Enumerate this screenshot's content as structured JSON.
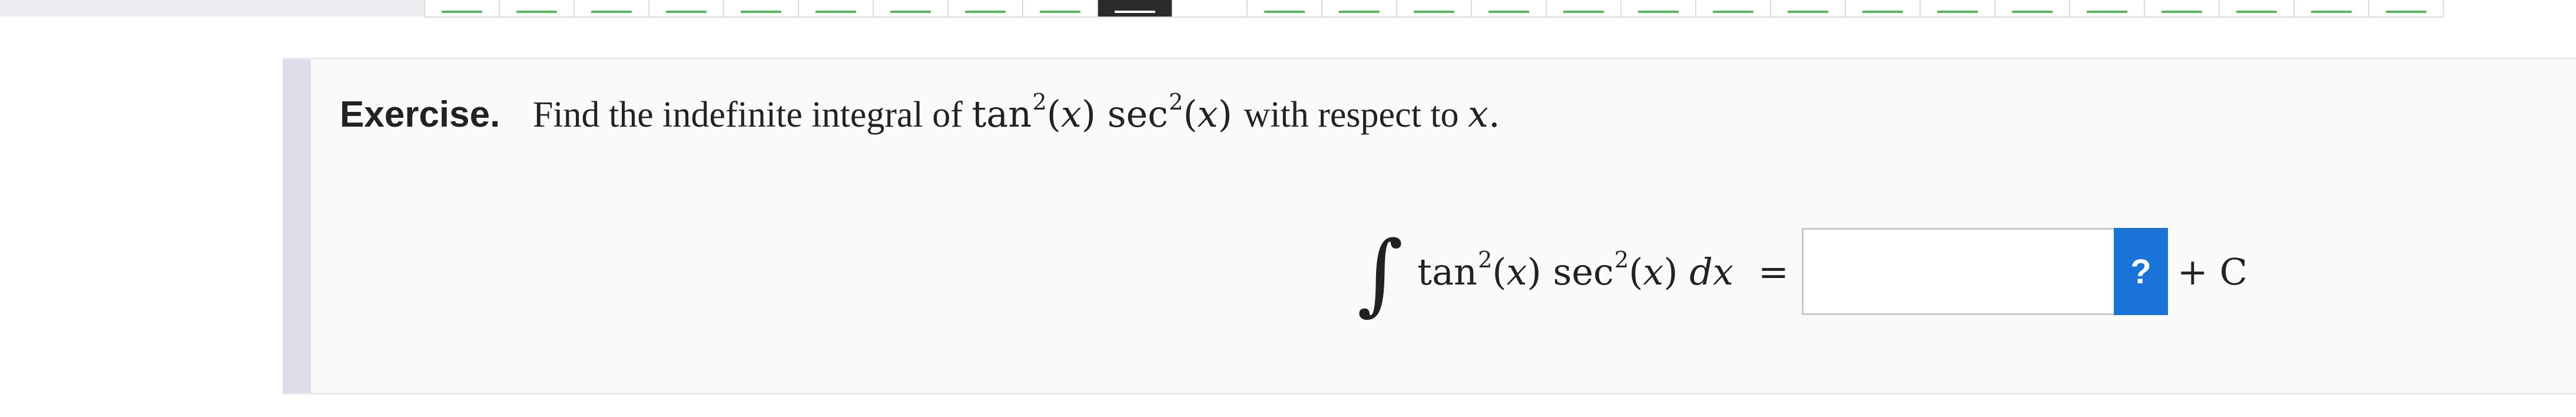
{
  "pager": {
    "cells": [
      {
        "state": "done"
      },
      {
        "state": "done"
      },
      {
        "state": "done"
      },
      {
        "state": "done"
      },
      {
        "state": "done"
      },
      {
        "state": "done"
      },
      {
        "state": "done"
      },
      {
        "state": "done"
      },
      {
        "state": "done"
      },
      {
        "state": "current"
      },
      {
        "state": "empty"
      },
      {
        "state": "done"
      },
      {
        "state": "done"
      },
      {
        "state": "done"
      },
      {
        "state": "done"
      },
      {
        "state": "done"
      },
      {
        "state": "done"
      },
      {
        "state": "done"
      },
      {
        "state": "done"
      },
      {
        "state": "done"
      },
      {
        "state": "done"
      },
      {
        "state": "done"
      },
      {
        "state": "done"
      },
      {
        "state": "done"
      },
      {
        "state": "done"
      },
      {
        "state": "done"
      },
      {
        "state": "done"
      }
    ],
    "done_color": "#5cb85c",
    "current_color": "#2b2b2b"
  },
  "exercise": {
    "label": "Exercise.",
    "prompt_before": "Find the indefinite integral of",
    "prompt_after": "with respect to",
    "variable": "x",
    "period": "."
  },
  "equation": {
    "integral_symbol": "∫",
    "tan": "tan",
    "sec": "sec",
    "exponent": "2",
    "open_paren": "(",
    "close_paren": ")",
    "dx": "dx",
    "equals": "=",
    "answer_value": "",
    "help_label": "?",
    "plus_c": "+ C"
  },
  "colors": {
    "accent": "#1a73d9",
    "panel_bar": "#dcdde9",
    "panel_bg": "#fafafa"
  }
}
